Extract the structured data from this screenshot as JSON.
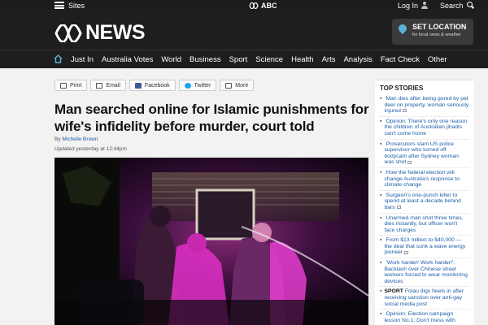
{
  "topbar": {
    "sites_label": "Sites",
    "abc_label": "ABC",
    "login_label": "Log In",
    "search_label": "Search"
  },
  "brand": {
    "name": "NEWS"
  },
  "set_location": {
    "title": "SET LOCATION",
    "subtitle": "for local news & weather"
  },
  "nav": {
    "items": [
      "Just In",
      "Australia Votes",
      "World",
      "Business",
      "Sport",
      "Science",
      "Health",
      "Arts",
      "Analysis",
      "Fact Check",
      "Other"
    ]
  },
  "share": {
    "print": "Print",
    "email": "Email",
    "facebook": "Facebook",
    "twitter": "Twitter",
    "more": "More"
  },
  "article": {
    "headline": "Man searched online for Islamic punishments for wife's infidelity before murder, court told",
    "by_prefix": "By",
    "author": "Michelle Brown",
    "updated": "Updated yesterday at 12:44pm"
  },
  "sidebar": {
    "title": "TOP STORIES",
    "stories": [
      {
        "tag": "",
        "text": "Man dies after being gored by pet deer on property, woman seriously injured",
        "video": true
      },
      {
        "tag": "",
        "text": "Opinion: There's only one reason the children of Australian jihadis can't come home",
        "video": false
      },
      {
        "tag": "",
        "text": "Prosecutors slam US police supervisor who turned off bodycam after Sydney woman was shot",
        "video": true
      },
      {
        "tag": "",
        "text": "How the federal election will change Australia's response to climate change",
        "video": false
      },
      {
        "tag": "",
        "text": "Surgeon's one-punch killer to spend at least a decade behind bars",
        "video": true
      },
      {
        "tag": "",
        "text": "Unarmed man shot three times, dies instantly, but officer won't face charges",
        "video": false
      },
      {
        "tag": "",
        "text": "From $13 million to $40,000 — the deal that sunk a wave energy pioneer",
        "video": true
      },
      {
        "tag": "",
        "text": "'Work harder! Work harder!': Backlash over Chinese street workers forced to wear monitoring devices",
        "video": false
      },
      {
        "tag": "SPORT",
        "text": "Folau digs heels in after receiving sanction over anti-gay social media post",
        "video": false
      },
      {
        "tag": "",
        "text": "Opinion: Election campaign lesson No.1: Don't mess with",
        "video": false
      }
    ]
  },
  "colors": {
    "header_bg": "#1e1e1e",
    "link_blue": "#1b5ea8",
    "location_pin": "#5ab3d8",
    "facebook": "#3b5998",
    "twitter": "#1da1f2"
  }
}
